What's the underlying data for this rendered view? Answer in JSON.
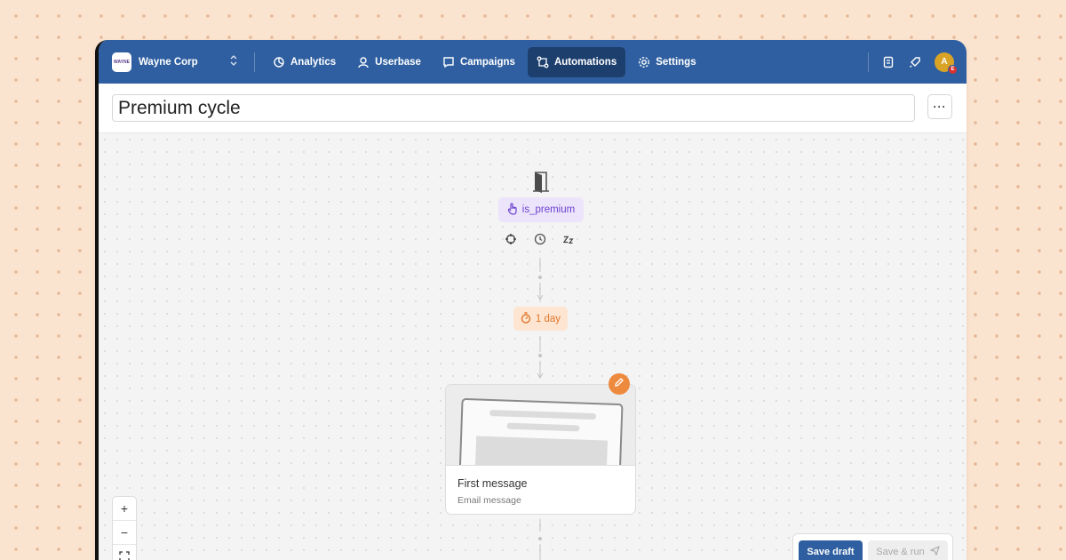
{
  "org": {
    "name": "Wayne Corp",
    "logo_text": "WAYNE"
  },
  "nav": {
    "items": [
      {
        "label": "Analytics",
        "icon": "analytics-icon",
        "active": false
      },
      {
        "label": "Userbase",
        "icon": "userbase-icon",
        "active": false
      },
      {
        "label": "Campaigns",
        "icon": "campaigns-icon",
        "active": false
      },
      {
        "label": "Automations",
        "icon": "automations-icon",
        "active": true
      },
      {
        "label": "Settings",
        "icon": "gear-icon",
        "active": false
      }
    ]
  },
  "user": {
    "initial": "A",
    "badge": "E"
  },
  "automation": {
    "title": "Premium cycle",
    "more_label": "···"
  },
  "trigger": {
    "event": "is_premium"
  },
  "delay": {
    "label": "1 day"
  },
  "message": {
    "title": "First message",
    "type": "Email message"
  },
  "zoom": {
    "in": "+",
    "out": "−"
  },
  "actions": {
    "save_draft": "Save draft",
    "save_run": "Save & run"
  },
  "colors": {
    "page_bg": "#fbe4cf",
    "topbar": "#2f5fa0",
    "nav_active": "#1d3f6e",
    "trigger_text": "#6b3fd0",
    "delay_text": "#e0772b",
    "edit_button": "#ee8a3e"
  }
}
